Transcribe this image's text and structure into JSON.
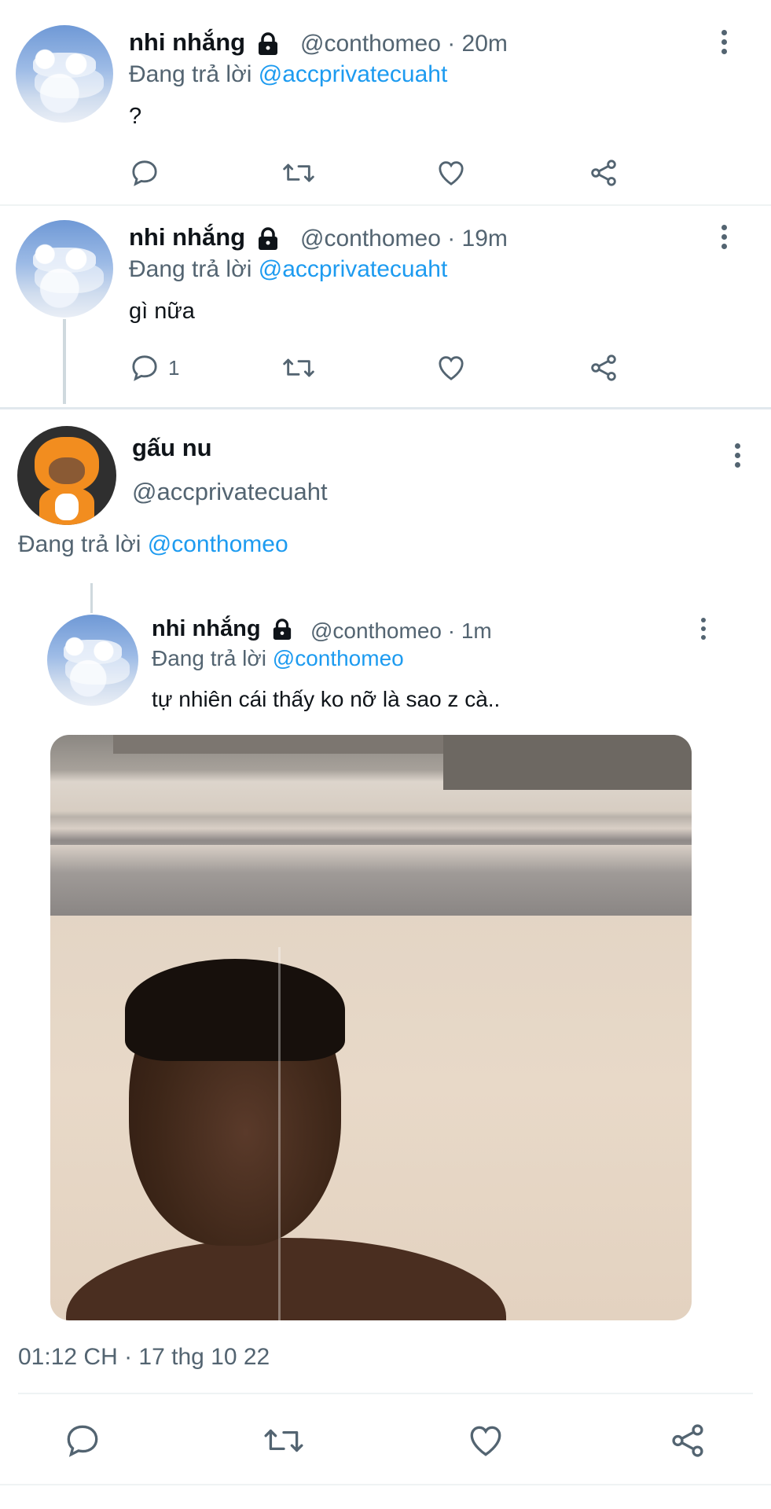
{
  "tweets": [
    {
      "name": "nhi nhắng",
      "handle_time": "@conthomeo · 20m",
      "reply_prefix": "Đang trả lời",
      "reply_to": "@accprivatecuaht",
      "text": "?",
      "reply_count": ""
    },
    {
      "name": "nhi nhắng",
      "handle_time": "@conthomeo · 19m",
      "reply_prefix": "Đang trả lời",
      "reply_to": "@accprivatecuaht",
      "text": "gì nữa",
      "reply_count": "1"
    }
  ],
  "main_tweet": {
    "name": "gấu nu",
    "handle": "@accprivatecuaht",
    "reply_prefix": "Đang trả lời",
    "reply_to": "@conthomeo",
    "timestamp": "01:12 CH · 17 thg 10 22"
  },
  "quoted": {
    "name": "nhi nhắng",
    "handle_time": "@conthomeo · 1m",
    "reply_prefix": "Đang trả lời",
    "reply_to": "@conthomeo",
    "text": "tự nhiên cái thấy ko nỡ là sao z cà.."
  },
  "icons": {
    "reply": "reply-icon",
    "retweet": "retweet-icon",
    "like": "heart-icon",
    "share": "share-icon",
    "more": "more-vertical-icon",
    "lock": "lock-icon"
  },
  "colors": {
    "link": "#1d9bf0",
    "secondary_text": "#536471",
    "primary_text": "#0f1419",
    "divider": "#eff3f4"
  }
}
